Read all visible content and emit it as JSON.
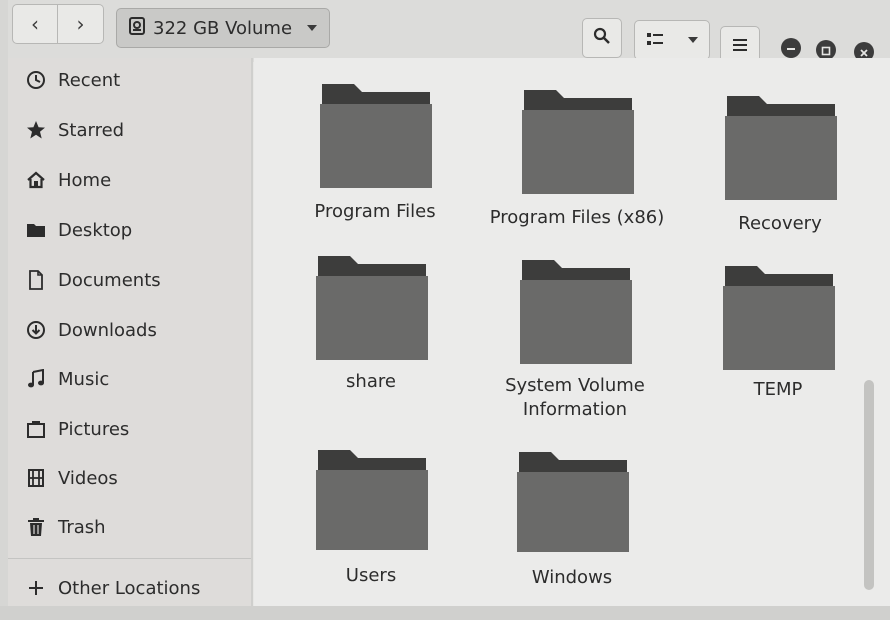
{
  "header": {
    "back_icon": "chevron-left-icon",
    "forward_icon": "chevron-right-icon",
    "location_label": "322 GB Volume",
    "location_icon": "drive-icon",
    "search_icon": "search-icon",
    "view_icon": "list-view-icon",
    "menu_icon": "hamburger-menu-icon",
    "window_controls": [
      "minimize",
      "maximize",
      "close"
    ]
  },
  "sidebar": {
    "items": [
      {
        "label": "Recent",
        "icon": "clock-icon"
      },
      {
        "label": "Starred",
        "icon": "star-icon"
      },
      {
        "label": "Home",
        "icon": "home-icon"
      },
      {
        "label": "Desktop",
        "icon": "folder-icon"
      },
      {
        "label": "Documents",
        "icon": "document-icon"
      },
      {
        "label": "Downloads",
        "icon": "download-icon"
      },
      {
        "label": "Music",
        "icon": "music-note-icon"
      },
      {
        "label": "Pictures",
        "icon": "picture-icon"
      },
      {
        "label": "Videos",
        "icon": "film-icon"
      },
      {
        "label": "Trash",
        "icon": "trash-icon"
      }
    ],
    "other_locations": {
      "label": "Other Locations",
      "icon": "plus-icon"
    }
  },
  "folders": {
    "items": [
      {
        "name": "Program Files"
      },
      {
        "name": "Program Files (x86)"
      },
      {
        "name": "Recovery"
      },
      {
        "name": "share"
      },
      {
        "name": "System Volume Information"
      },
      {
        "name": "TEMP"
      },
      {
        "name": "Users"
      },
      {
        "name": "Windows"
      }
    ]
  },
  "colors": {
    "folder_body": "#6a6a69",
    "folder_tab": "#3d3d3c"
  }
}
